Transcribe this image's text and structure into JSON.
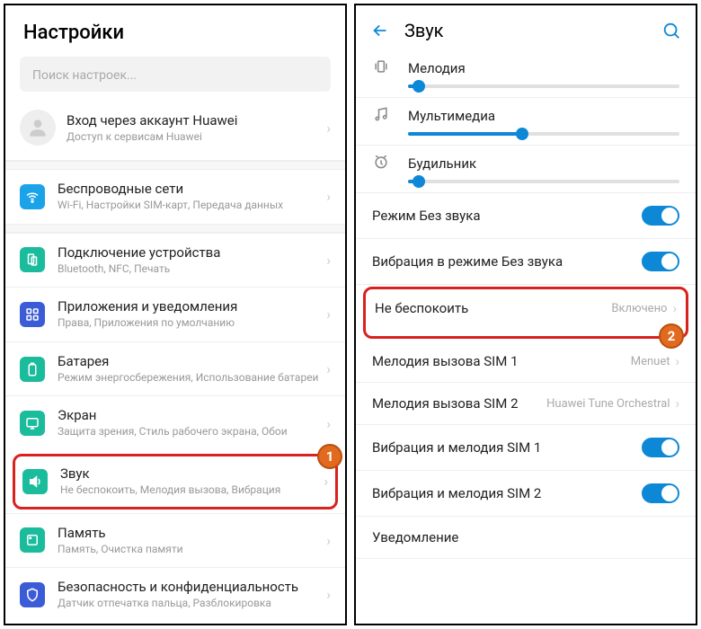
{
  "left": {
    "title": "Настройки",
    "search_placeholder": "Поиск настроек...",
    "account": {
      "title": "Вход через аккаунт Huawei",
      "sub": "Доступ к сервисам Huawei"
    },
    "items": [
      {
        "title": "Беспроводные сети",
        "sub": "Wi-Fi, Настройки SIM-карт, Передача данных",
        "color": "#1aa3e8",
        "icon": "wifi"
      },
      {
        "title": "Подключение устройства",
        "sub": "Bluetooth, NFC, Печать",
        "color": "#1abc9c",
        "icon": "device"
      },
      {
        "title": "Приложения и уведомления",
        "sub": "Права, Приложения по умолчанию",
        "color": "#3b5cd6",
        "icon": "apps"
      },
      {
        "title": "Батарея",
        "sub": "Режим энергосбережения, Использование батареи",
        "color": "#1abc9c",
        "icon": "battery"
      },
      {
        "title": "Экран",
        "sub": "Защита зрения, Стиль рабочего экрана, Обои",
        "color": "#1abc9c",
        "icon": "display"
      },
      {
        "title": "Звук",
        "sub": "Не беспокоить, Мелодия вызова, Вибрация",
        "color": "#1abc9c",
        "icon": "sound",
        "highlight": true,
        "badge": "1"
      },
      {
        "title": "Память",
        "sub": "Память, Очистка памяти",
        "color": "#1abc9c",
        "icon": "storage"
      },
      {
        "title": "Безопасность и конфиденциальность",
        "sub": "Датчик отпечатка пальца, Разблокировка",
        "color": "#3b5cd6",
        "icon": "security"
      }
    ]
  },
  "right": {
    "title": "Звук",
    "sliders": [
      {
        "label": "Мелодия",
        "icon": "vibrate",
        "fill": 4
      },
      {
        "label": "Мультимедиа",
        "icon": "music",
        "fill": 42
      },
      {
        "label": "Будильник",
        "icon": "alarm",
        "fill": 4
      }
    ],
    "rows": [
      {
        "label": "Режим Без звука",
        "toggle": true,
        "on": true
      },
      {
        "label": "Вибрация в режиме Без звука",
        "toggle": true,
        "on": true
      },
      {
        "label": "Не беспокоить",
        "value": "Включено",
        "highlight": true,
        "badge": "2",
        "chev": true
      },
      {
        "label": "Мелодия вызова SIM 1",
        "value": "Menuet",
        "chev": true
      },
      {
        "label": "Мелодия вызова SIM 2",
        "value": "Huawei Tune Orchestral",
        "chev": true
      },
      {
        "label": "Вибрация и мелодия SIM 1",
        "toggle": true,
        "on": true
      },
      {
        "label": "Вибрация и мелодия SIM 2",
        "toggle": true,
        "on": true
      },
      {
        "label": "Уведомление"
      }
    ]
  }
}
